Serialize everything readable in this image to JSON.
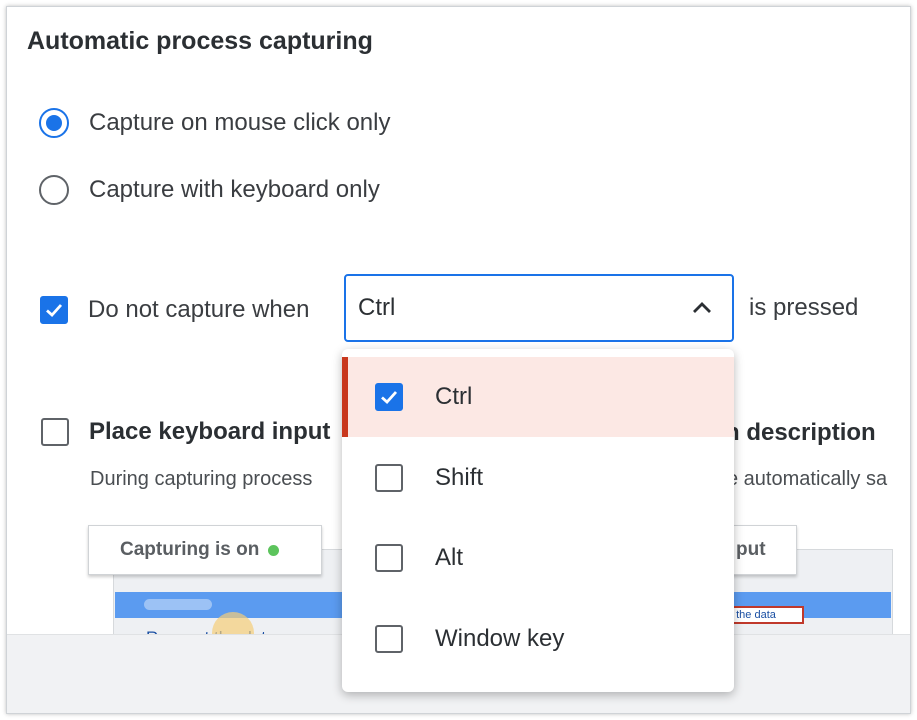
{
  "section": {
    "title": "Automatic process capturing"
  },
  "capture_mode": {
    "options": [
      {
        "label": "Capture on mouse click only",
        "selected": true
      },
      {
        "label": "Capture with keyboard only",
        "selected": false
      }
    ]
  },
  "exclude_key": {
    "checked": true,
    "label_before": "Do not capture when",
    "selected_value": "Ctrl",
    "label_after": "is pressed",
    "dropdown_open": true,
    "options": [
      {
        "label": "Ctrl",
        "checked": true
      },
      {
        "label": "Shift",
        "checked": false
      },
      {
        "label": "Alt",
        "checked": false
      },
      {
        "label": "Window key",
        "checked": false
      }
    ]
  },
  "keyboard_input": {
    "checked": false,
    "title_left": "Place keyboard input",
    "title_right": "n description",
    "description_left": "During capturing process",
    "description_right": "e automatically sa"
  },
  "illustration": {
    "capturing_label": "Capturing is on",
    "input_label": "put",
    "link_text": "Request the data",
    "highlight_text": "t the data"
  },
  "colors": {
    "accent": "#1a73e8",
    "selected_bg": "#fce8e4",
    "selected_bar": "#c8381e",
    "status_green": "#5cc45c"
  }
}
